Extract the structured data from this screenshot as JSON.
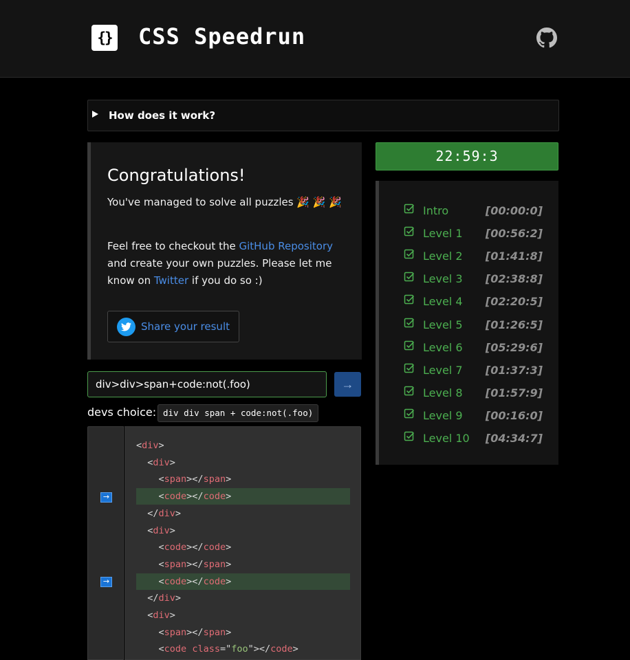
{
  "header": {
    "logo_glyph": "{}",
    "title": "CSS Speedrun",
    "github_icon": "github-icon"
  },
  "details": {
    "summary": "How does it work?"
  },
  "congrats": {
    "title": "Congratulations!",
    "solved_text": "You've managed to solve all puzzles 🎉 🎉 🎉",
    "p2_before": "Feel free to checkout the ",
    "github_link": "GitHub Repository",
    "p2_middle": " and create your own puzzles. Please let me know on ",
    "twitter_link": "Twitter",
    "p2_after": " if you do so :)",
    "share_label": "Share your result"
  },
  "answer": {
    "value": "div>div>span+code:not(.foo)",
    "submit_glyph": "→"
  },
  "devs_choice": {
    "label": "devs choice:",
    "code": "div div span + code:not(.foo)"
  },
  "code_lines": [
    {
      "indent": "",
      "parts": [
        [
          "p",
          "<"
        ],
        [
          "t",
          "div"
        ],
        [
          "p",
          ">"
        ]
      ]
    },
    {
      "indent": "  ",
      "parts": [
        [
          "p",
          "<"
        ],
        [
          "t",
          "div"
        ],
        [
          "p",
          ">"
        ]
      ]
    },
    {
      "indent": "    ",
      "parts": [
        [
          "p",
          "<"
        ],
        [
          "t",
          "span"
        ],
        [
          "p",
          "></"
        ],
        [
          "t",
          "span"
        ],
        [
          "p",
          ">"
        ]
      ]
    },
    {
      "indent": "    ",
      "parts": [
        [
          "p",
          "<"
        ],
        [
          "t",
          "code"
        ],
        [
          "p",
          "></"
        ],
        [
          "t",
          "code"
        ],
        [
          "p",
          ">"
        ]
      ],
      "highlight": true
    },
    {
      "indent": "  ",
      "parts": [
        [
          "p",
          "</"
        ],
        [
          "t",
          "div"
        ],
        [
          "p",
          ">"
        ]
      ]
    },
    {
      "indent": "  ",
      "parts": [
        [
          "p",
          "<"
        ],
        [
          "t",
          "div"
        ],
        [
          "p",
          ">"
        ]
      ]
    },
    {
      "indent": "    ",
      "parts": [
        [
          "p",
          "<"
        ],
        [
          "t",
          "code"
        ],
        [
          "p",
          "></"
        ],
        [
          "t",
          "code"
        ],
        [
          "p",
          ">"
        ]
      ]
    },
    {
      "indent": "    ",
      "parts": [
        [
          "p",
          "<"
        ],
        [
          "t",
          "span"
        ],
        [
          "p",
          "></"
        ],
        [
          "t",
          "span"
        ],
        [
          "p",
          ">"
        ]
      ]
    },
    {
      "indent": "    ",
      "parts": [
        [
          "p",
          "<"
        ],
        [
          "t",
          "code"
        ],
        [
          "p",
          "></"
        ],
        [
          "t",
          "code"
        ],
        [
          "p",
          ">"
        ]
      ],
      "highlight": true
    },
    {
      "indent": "  ",
      "parts": [
        [
          "p",
          "</"
        ],
        [
          "t",
          "div"
        ],
        [
          "p",
          ">"
        ]
      ]
    },
    {
      "indent": "  ",
      "parts": [
        [
          "p",
          "<"
        ],
        [
          "t",
          "div"
        ],
        [
          "p",
          ">"
        ]
      ]
    },
    {
      "indent": "    ",
      "parts": [
        [
          "p",
          "<"
        ],
        [
          "t",
          "span"
        ],
        [
          "p",
          "></"
        ],
        [
          "t",
          "span"
        ],
        [
          "p",
          ">"
        ]
      ]
    },
    {
      "indent": "    ",
      "parts": [
        [
          "p",
          "<"
        ],
        [
          "t",
          "code"
        ],
        [
          "p",
          " "
        ],
        [
          "a",
          "class"
        ],
        [
          "p",
          "=\""
        ],
        [
          "s",
          "foo"
        ],
        [
          "p",
          "\"></"
        ],
        [
          "t",
          "code"
        ],
        [
          "p",
          ">"
        ]
      ]
    }
  ],
  "marker_glyph": "→",
  "timer": "22:59:3",
  "levels": [
    {
      "name": "Intro",
      "time": "[00:00:0]"
    },
    {
      "name": "Level 1",
      "time": "[00:56:2]"
    },
    {
      "name": "Level 2",
      "time": "[01:41:8]"
    },
    {
      "name": "Level 3",
      "time": "[02:38:8]"
    },
    {
      "name": "Level 4",
      "time": "[02:20:5]"
    },
    {
      "name": "Level 5",
      "time": "[01:26:5]"
    },
    {
      "name": "Level 6",
      "time": "[05:29:6]"
    },
    {
      "name": "Level 7",
      "time": "[01:37:3]"
    },
    {
      "name": "Level 8",
      "time": "[01:57:9]"
    },
    {
      "name": "Level 9",
      "time": "[00:16:0]"
    },
    {
      "name": "Level 10",
      "time": "[04:34:7]"
    }
  ],
  "colors": {
    "accent_green": "#4caf50",
    "timer_bg": "#2e7d32",
    "link_blue": "#4a8de6",
    "highlight": "#344a37"
  }
}
